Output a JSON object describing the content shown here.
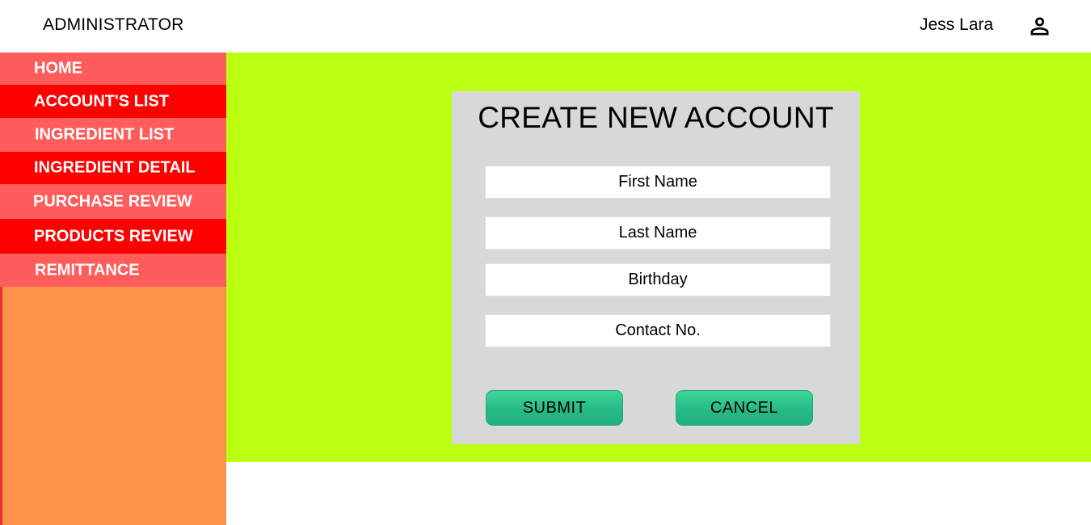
{
  "header": {
    "app_title": "ADMINISTRATOR",
    "user_name": "Jess Lara",
    "user_icon": "user-icon"
  },
  "sidebar": {
    "items": [
      {
        "label": "HOME",
        "bg": "#ff5c5c"
      },
      {
        "label": "ACCOUNT'S LIST",
        "bg": "#ff0000"
      },
      {
        "label": "INGREDIENT LIST",
        "bg": "#ff5c5c"
      },
      {
        "label": "INGREDIENT DETAIL",
        "bg": "#ff0000"
      },
      {
        "label": "PURCHASE REVIEW",
        "bg": "#ff5c5c"
      },
      {
        "label": "PRODUCTS REVIEW",
        "bg": "#ff0000"
      },
      {
        "label": "REMITTANCE",
        "bg": "#ff5c5c"
      }
    ],
    "background": "#ff914d"
  },
  "main": {
    "background": "#bbff12"
  },
  "form": {
    "title": "CREATE NEW ACCOUNT",
    "fields": {
      "first_name": {
        "placeholder": "First Name",
        "value": ""
      },
      "last_name": {
        "placeholder": "Last Name",
        "value": ""
      },
      "birthday": {
        "placeholder": "Birthday",
        "value": ""
      },
      "contact_no": {
        "placeholder": "Contact No.",
        "value": ""
      }
    },
    "submit_label": "SUBMIT",
    "cancel_label": "CANCEL",
    "button_color": "#2bc48c"
  }
}
